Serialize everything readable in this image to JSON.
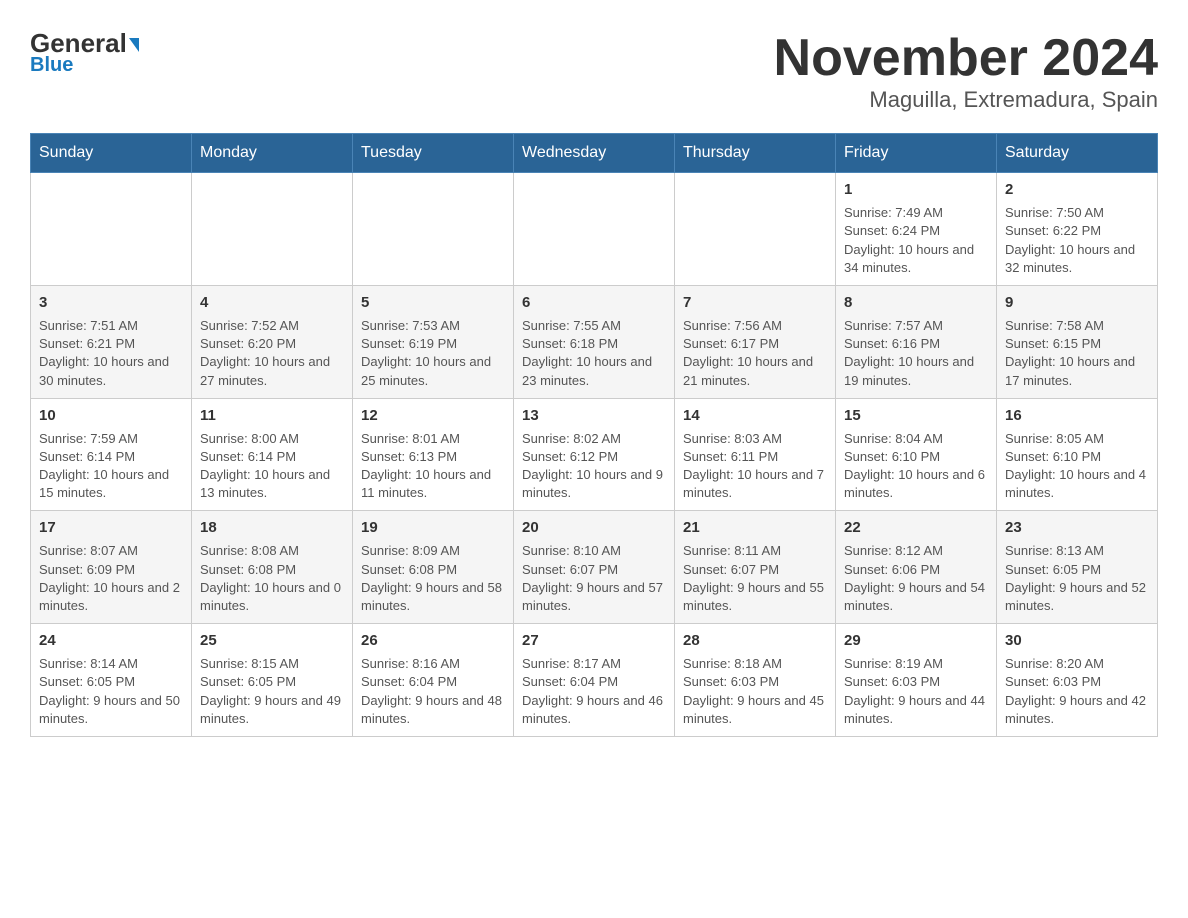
{
  "header": {
    "logo_main": "General",
    "logo_sub": "Blue",
    "title": "November 2024",
    "subtitle": "Maguilla, Extremadura, Spain"
  },
  "days_of_week": [
    "Sunday",
    "Monday",
    "Tuesday",
    "Wednesday",
    "Thursday",
    "Friday",
    "Saturday"
  ],
  "weeks": [
    {
      "days": [
        {
          "num": "",
          "info": ""
        },
        {
          "num": "",
          "info": ""
        },
        {
          "num": "",
          "info": ""
        },
        {
          "num": "",
          "info": ""
        },
        {
          "num": "",
          "info": ""
        },
        {
          "num": "1",
          "info": "Sunrise: 7:49 AM\nSunset: 6:24 PM\nDaylight: 10 hours and 34 minutes."
        },
        {
          "num": "2",
          "info": "Sunrise: 7:50 AM\nSunset: 6:22 PM\nDaylight: 10 hours and 32 minutes."
        }
      ]
    },
    {
      "days": [
        {
          "num": "3",
          "info": "Sunrise: 7:51 AM\nSunset: 6:21 PM\nDaylight: 10 hours and 30 minutes."
        },
        {
          "num": "4",
          "info": "Sunrise: 7:52 AM\nSunset: 6:20 PM\nDaylight: 10 hours and 27 minutes."
        },
        {
          "num": "5",
          "info": "Sunrise: 7:53 AM\nSunset: 6:19 PM\nDaylight: 10 hours and 25 minutes."
        },
        {
          "num": "6",
          "info": "Sunrise: 7:55 AM\nSunset: 6:18 PM\nDaylight: 10 hours and 23 minutes."
        },
        {
          "num": "7",
          "info": "Sunrise: 7:56 AM\nSunset: 6:17 PM\nDaylight: 10 hours and 21 minutes."
        },
        {
          "num": "8",
          "info": "Sunrise: 7:57 AM\nSunset: 6:16 PM\nDaylight: 10 hours and 19 minutes."
        },
        {
          "num": "9",
          "info": "Sunrise: 7:58 AM\nSunset: 6:15 PM\nDaylight: 10 hours and 17 minutes."
        }
      ]
    },
    {
      "days": [
        {
          "num": "10",
          "info": "Sunrise: 7:59 AM\nSunset: 6:14 PM\nDaylight: 10 hours and 15 minutes."
        },
        {
          "num": "11",
          "info": "Sunrise: 8:00 AM\nSunset: 6:14 PM\nDaylight: 10 hours and 13 minutes."
        },
        {
          "num": "12",
          "info": "Sunrise: 8:01 AM\nSunset: 6:13 PM\nDaylight: 10 hours and 11 minutes."
        },
        {
          "num": "13",
          "info": "Sunrise: 8:02 AM\nSunset: 6:12 PM\nDaylight: 10 hours and 9 minutes."
        },
        {
          "num": "14",
          "info": "Sunrise: 8:03 AM\nSunset: 6:11 PM\nDaylight: 10 hours and 7 minutes."
        },
        {
          "num": "15",
          "info": "Sunrise: 8:04 AM\nSunset: 6:10 PM\nDaylight: 10 hours and 6 minutes."
        },
        {
          "num": "16",
          "info": "Sunrise: 8:05 AM\nSunset: 6:10 PM\nDaylight: 10 hours and 4 minutes."
        }
      ]
    },
    {
      "days": [
        {
          "num": "17",
          "info": "Sunrise: 8:07 AM\nSunset: 6:09 PM\nDaylight: 10 hours and 2 minutes."
        },
        {
          "num": "18",
          "info": "Sunrise: 8:08 AM\nSunset: 6:08 PM\nDaylight: 10 hours and 0 minutes."
        },
        {
          "num": "19",
          "info": "Sunrise: 8:09 AM\nSunset: 6:08 PM\nDaylight: 9 hours and 58 minutes."
        },
        {
          "num": "20",
          "info": "Sunrise: 8:10 AM\nSunset: 6:07 PM\nDaylight: 9 hours and 57 minutes."
        },
        {
          "num": "21",
          "info": "Sunrise: 8:11 AM\nSunset: 6:07 PM\nDaylight: 9 hours and 55 minutes."
        },
        {
          "num": "22",
          "info": "Sunrise: 8:12 AM\nSunset: 6:06 PM\nDaylight: 9 hours and 54 minutes."
        },
        {
          "num": "23",
          "info": "Sunrise: 8:13 AM\nSunset: 6:05 PM\nDaylight: 9 hours and 52 minutes."
        }
      ]
    },
    {
      "days": [
        {
          "num": "24",
          "info": "Sunrise: 8:14 AM\nSunset: 6:05 PM\nDaylight: 9 hours and 50 minutes."
        },
        {
          "num": "25",
          "info": "Sunrise: 8:15 AM\nSunset: 6:05 PM\nDaylight: 9 hours and 49 minutes."
        },
        {
          "num": "26",
          "info": "Sunrise: 8:16 AM\nSunset: 6:04 PM\nDaylight: 9 hours and 48 minutes."
        },
        {
          "num": "27",
          "info": "Sunrise: 8:17 AM\nSunset: 6:04 PM\nDaylight: 9 hours and 46 minutes."
        },
        {
          "num": "28",
          "info": "Sunrise: 8:18 AM\nSunset: 6:03 PM\nDaylight: 9 hours and 45 minutes."
        },
        {
          "num": "29",
          "info": "Sunrise: 8:19 AM\nSunset: 6:03 PM\nDaylight: 9 hours and 44 minutes."
        },
        {
          "num": "30",
          "info": "Sunrise: 8:20 AM\nSunset: 6:03 PM\nDaylight: 9 hours and 42 minutes."
        }
      ]
    }
  ]
}
